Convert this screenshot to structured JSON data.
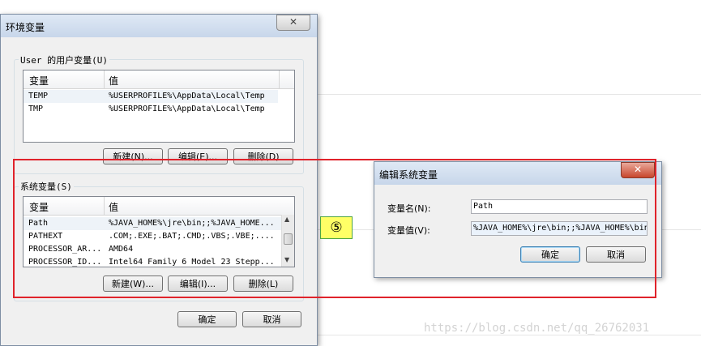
{
  "env_dialog": {
    "title": "环境变量",
    "close_glyph": "✕",
    "user_group_label": "User 的用户变量(U)",
    "user_headers": [
      "变量",
      "值"
    ],
    "user_rows": [
      {
        "name": "TEMP",
        "value": "%USERPROFILE%\\AppData\\Local\\Temp"
      },
      {
        "name": "TMP",
        "value": "%USERPROFILE%\\AppData\\Local\\Temp"
      }
    ],
    "user_buttons": [
      "新建(N)...",
      "编辑(E)...",
      "删除(D)"
    ],
    "sys_group_label": "系统变量(S)",
    "sys_headers": [
      "变量",
      "值"
    ],
    "sys_rows": [
      {
        "name": "Path",
        "value": "%JAVA_HOME%\\jre\\bin;;%JAVA_HOME..."
      },
      {
        "name": "PATHEXT",
        "value": ".COM;.EXE;.BAT;.CMD;.VBS;.VBE;...."
      },
      {
        "name": "PROCESSOR_AR...",
        "value": "AMD64"
      },
      {
        "name": "PROCESSOR_ID...",
        "value": "Intel64 Family 6 Model 23 Stepp..."
      }
    ],
    "sys_buttons": [
      "新建(W)...",
      "编辑(I)...",
      "删除(L)"
    ],
    "ok_label": "确定",
    "cancel_label": "取消"
  },
  "edit_dialog": {
    "title": "编辑系统变量",
    "close_glyph": "✕",
    "name_label": "变量名(N):",
    "name_value": "Path",
    "value_label": "变量值(V):",
    "value_value": "%JAVA_HOME%\\jre\\bin;;%JAVA_HOME%\\bin",
    "ok_label": "确定",
    "cancel_label": "取消"
  },
  "annotation": {
    "step_marker": "⑤",
    "highlight_color": "#e0232b"
  },
  "watermark": "https://blog.csdn.net/qq_26762031"
}
